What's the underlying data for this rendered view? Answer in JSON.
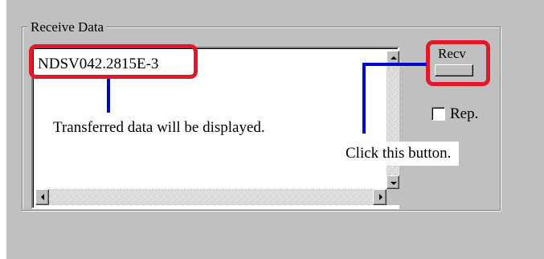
{
  "groupbox": {
    "title": "Receive Data"
  },
  "receive_area": {
    "value": "NDSV042.2815E-3"
  },
  "recv_button": {
    "label": "Recv"
  },
  "repeat_checkbox": {
    "label": "Rep.",
    "checked": false
  },
  "annotations": {
    "display_note": "Transferred data will be displayed.",
    "button_note": "Click this button."
  },
  "colors": {
    "highlight": "#e0182a",
    "pointer": "#0000cc",
    "panel": "#c0c0c0"
  },
  "icons": {
    "scroll_up": "triangle-up-icon",
    "scroll_down": "triangle-down-icon",
    "scroll_left": "triangle-left-icon",
    "scroll_right": "triangle-right-icon"
  }
}
